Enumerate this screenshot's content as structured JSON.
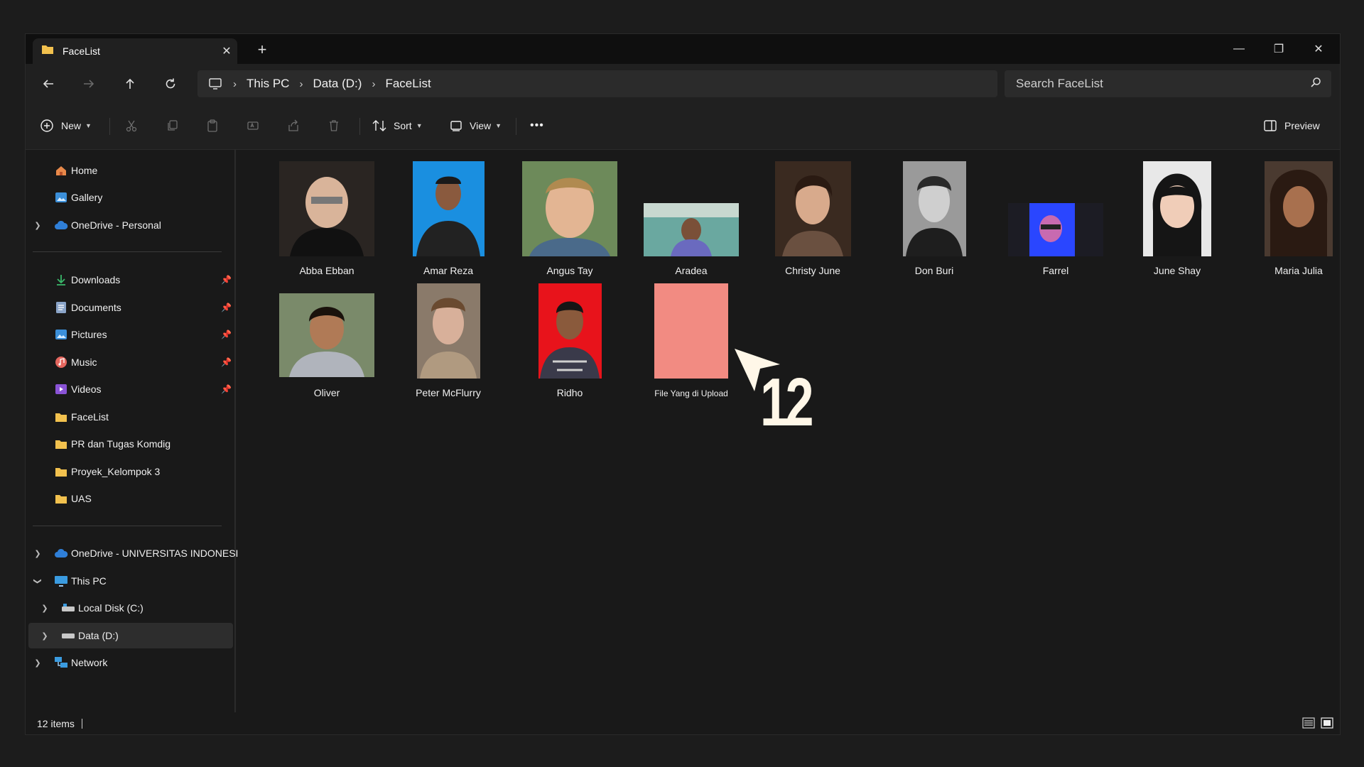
{
  "tab": {
    "title": "FaceList",
    "close": "✕",
    "new": "+"
  },
  "window_controls": {
    "minimize": "—",
    "maximize": "❐",
    "close": "✕"
  },
  "breadcrumb": [
    "This PC",
    "Data (D:)",
    "FaceList"
  ],
  "search": {
    "placeholder": "Search FaceList"
  },
  "toolbar": {
    "new_label": "New",
    "sort_label": "Sort",
    "view_label": "View",
    "more_label": "•••",
    "preview_label": "Preview"
  },
  "sidebar": {
    "home": "Home",
    "gallery": "Gallery",
    "onedrive_personal": "OneDrive - Personal",
    "downloads": "Downloads",
    "documents": "Documents",
    "pictures": "Pictures",
    "music": "Music",
    "videos": "Videos",
    "facelist": "FaceList",
    "pr": "PR dan Tugas Komdig",
    "proyek": "Proyek_Kelompok 3",
    "uas": "UAS",
    "onedrive_ui": "OneDrive - UNIVERSITAS INDONESI",
    "this_pc": "This PC",
    "local_c": "Local Disk (C:)",
    "data_d": "Data (D:)",
    "network": "Network"
  },
  "files": [
    {
      "name": "Abba Ebban"
    },
    {
      "name": "Amar Reza"
    },
    {
      "name": "Angus Tay"
    },
    {
      "name": "Aradea"
    },
    {
      "name": "Christy June"
    },
    {
      "name": "Don Buri"
    },
    {
      "name": "Farrel"
    },
    {
      "name": "June Shay"
    },
    {
      "name": "Maria Julia"
    },
    {
      "name": "Oliver"
    },
    {
      "name": "Peter McFlurry"
    },
    {
      "name": "Ridho"
    },
    {
      "name": "File Yang di Upload"
    }
  ],
  "annotation": {
    "number": "12"
  },
  "status": {
    "count": "12 items"
  },
  "colors": {
    "accent_folder": "#f2c14e",
    "upload_thumb": "#f28b82",
    "ridho_bg": "#e8131b",
    "amar_bg": "#1a8fe0"
  }
}
